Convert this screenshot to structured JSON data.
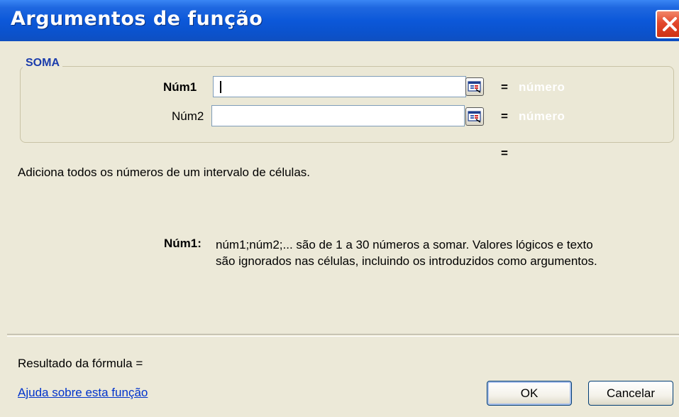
{
  "window": {
    "title": "Argumentos de função"
  },
  "function_group": {
    "name": "SOMA",
    "args": [
      {
        "label": "Núm1",
        "value": "",
        "result_eq": "=",
        "result_hint": "número"
      },
      {
        "label": "Núm2",
        "value": "",
        "result_eq": "=",
        "result_hint": "número"
      }
    ],
    "function_result_eq": "="
  },
  "description": "Adiciona todos os números de um intervalo de células.",
  "arg_description": {
    "label": "Núm1:",
    "line1": "núm1;núm2;... são de 1 a 30 números a somar. Valores lógicos e texto",
    "line2": "são ignorados nas células, incluindo os introduzidos como argumentos."
  },
  "footer": {
    "result_label": "Resultado da fórmula =",
    "help_link": "Ajuda sobre esta função",
    "ok_label": "OK",
    "cancel_label": "Cancelar"
  },
  "icons": {
    "close": "close-icon",
    "collapse_dialog": "collapse-dialog-icon"
  },
  "colors": {
    "titlebar": "#0c58d9",
    "group_legend": "#1c3dac",
    "link": "#0033cc",
    "close": "#e2482c"
  }
}
